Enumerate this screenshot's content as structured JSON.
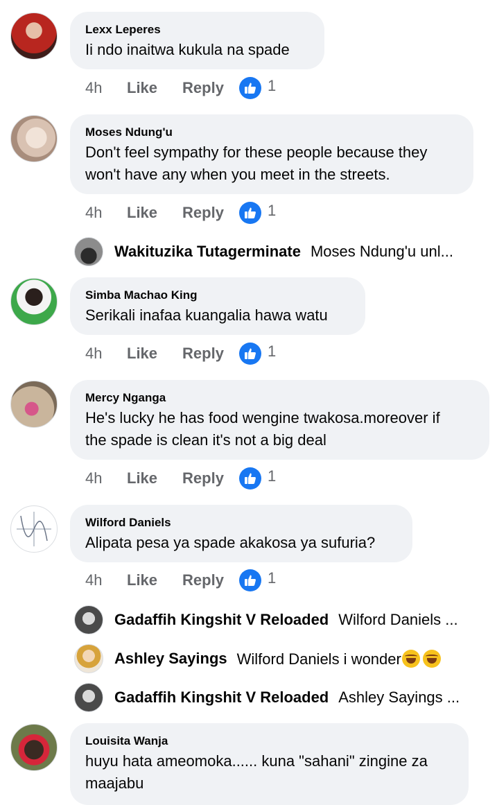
{
  "comments": [
    {
      "author": "Lexx Leperes",
      "text": "Ii ndo inaitwa kukula na spade",
      "time": "4h",
      "like_label": "Like",
      "reply_label": "Reply",
      "likes": "1",
      "avatar_colors": [
        "#b8261f",
        "#3f1d1a"
      ]
    },
    {
      "author": "Moses Ndung'u",
      "text_lines": [
        "Don't feel sympathy for these people because they",
        "won't have any when you meet in the streets."
      ],
      "time": "4h",
      "like_label": "Like",
      "reply_label": "Reply",
      "likes": "1",
      "avatar_colors": [
        "#e4d2c4",
        "#a88d7c"
      ],
      "reply_preview": {
        "name": "Wakituzika Tutagerminate",
        "text": "Moses Ndung'u unl..."
      }
    },
    {
      "author": "Simba Machao King",
      "text": "Serikali inafaa kuangalia hawa watu",
      "time": "4h",
      "like_label": "Like",
      "reply_label": "Reply",
      "likes": "1",
      "avatar_colors": [
        "#3da84a",
        "#2a1f1c"
      ]
    },
    {
      "author": "Mercy Nganga",
      "text_lines": [
        "He's lucky he has food wengine twakosa.moreover if",
        "the spade is clean it's not a big deal"
      ],
      "time": "4h",
      "like_label": "Like",
      "reply_label": "Reply",
      "likes": "1",
      "avatar_colors": [
        "#c9b59c",
        "#d6578a"
      ]
    },
    {
      "author": "Wilford Daniels",
      "text": "Alipata pesa ya spade akakosa ya sufuria?",
      "time": "4h",
      "like_label": "Like",
      "reply_label": "Reply",
      "likes": "1",
      "avatar_colors": [
        "#ffffff",
        "#8a94a6"
      ],
      "replies": [
        {
          "name": "Gadaffih Kingshit V Reloaded",
          "text": "Wilford Daniels ..."
        },
        {
          "name": "Ashley Sayings",
          "text": "Wilford Daniels i wonder"
        },
        {
          "name": "Gadaffih Kingshit V Reloaded",
          "text": "Ashley Sayings ..."
        }
      ]
    },
    {
      "author": "Louisita Wanja",
      "text_lines": [
        "huyu hata ameomoka...... kuna \"sahani\" zingine za",
        "maajabu"
      ],
      "avatar_colors": [
        "#d6263a",
        "#3a2a22"
      ]
    }
  ]
}
